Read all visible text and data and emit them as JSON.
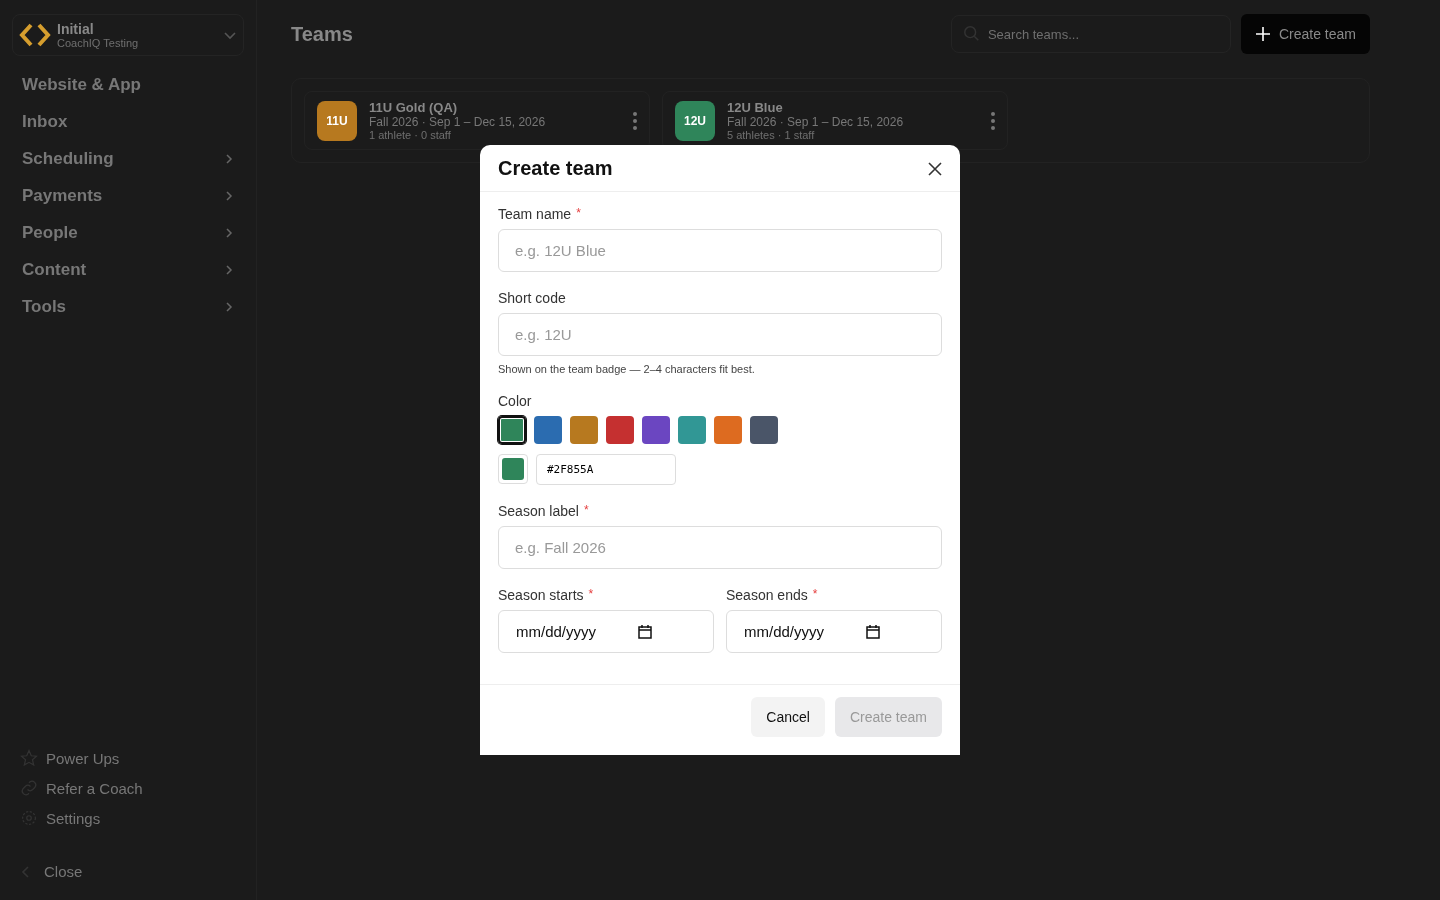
{
  "workspace": {
    "name": "Initial",
    "subtitle": "CoachIQ Testing"
  },
  "nav": [
    {
      "label": "Website & App",
      "expandable": false
    },
    {
      "label": "Inbox",
      "expandable": false
    },
    {
      "label": "Scheduling",
      "expandable": true
    },
    {
      "label": "Payments",
      "expandable": true
    },
    {
      "label": "People",
      "expandable": true
    },
    {
      "label": "Content",
      "expandable": true
    },
    {
      "label": "Tools",
      "expandable": true
    }
  ],
  "footer_nav": [
    {
      "label": "Power Ups",
      "kind": "star"
    },
    {
      "label": "Refer a Coach",
      "kind": "link"
    },
    {
      "label": "Settings",
      "kind": "gear"
    }
  ],
  "close_label": "Close",
  "page": {
    "title": "Teams",
    "search": {
      "placeholder": "Search teams..."
    },
    "create_button": "Create team"
  },
  "teams": [
    {
      "code": "11U",
      "name": "11U Gold (QA)",
      "dates": "Fall 2026 · Sep 1 – Dec 15, 2026",
      "counts": "1 athlete · 0 staff",
      "color": "#b7791f"
    },
    {
      "code": "12U",
      "name": "12U Blue",
      "dates": "Fall 2026 · Sep 1 – Dec 15, 2026",
      "counts": "5 athletes · 1 staff",
      "color": "#2f855a"
    }
  ],
  "dialog": {
    "title": "Create team",
    "required_mark": "*",
    "team_name": {
      "label": "Team name",
      "required": true,
      "placeholder": "e.g. 12U Blue"
    },
    "short_code": {
      "label": "Short code",
      "required": false,
      "placeholder": "e.g. 12U",
      "hint": "Shown on the team badge — 2–4 characters fit best."
    },
    "color": {
      "label": "Color",
      "value": "#2F855A",
      "swatches": [
        {
          "color": "#2f855a",
          "selected": true
        },
        {
          "color": "#2b6cb0",
          "selected": false
        },
        {
          "color": "#b7791f",
          "selected": false
        },
        {
          "color": "#c53030",
          "selected": false
        },
        {
          "color": "#6b46c1",
          "selected": false
        },
        {
          "color": "#319795",
          "selected": false
        },
        {
          "color": "#dd6b20",
          "selected": false
        },
        {
          "color": "#4a5568",
          "selected": false
        }
      ]
    },
    "season_label": {
      "label": "Season label",
      "required": true,
      "placeholder": "e.g. Fall 2026"
    },
    "season_starts": {
      "label": "Season starts",
      "required": true,
      "value": "mm/dd/yyyy"
    },
    "season_ends": {
      "label": "Season ends",
      "required": true,
      "value": "mm/dd/yyyy"
    },
    "cancel": "Cancel",
    "submit": {
      "label": "Create team",
      "disabled": true
    }
  }
}
